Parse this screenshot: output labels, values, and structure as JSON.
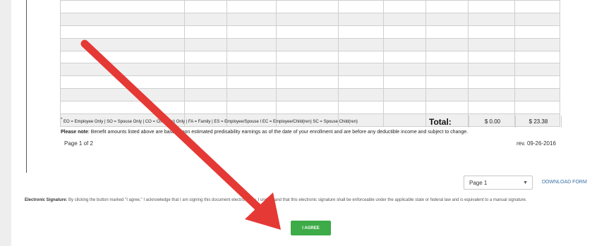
{
  "document": {
    "legend": "EO = Employee Only | SO = Spouse Only | CO = Child(ren) Only | FA = Family | ES = Employee/Spouse I EC = Employee/Child(ren) SC = Spouse Child(ren)",
    "legend_marker": "*",
    "total_label": "Total:",
    "totals": [
      "$ 0.00",
      "$ 23.38"
    ],
    "note_label": "Please note",
    "note_text": ": Benefit amounts listed above are based upon estimated predisability earnings as of the date of your enrollment and are before any deductible income and subject to change.",
    "page_indicator": "Page 1 of 2",
    "revision": "rev. 09-26-2016"
  },
  "controls": {
    "page_select_value": "Page 1",
    "download_label": "DOWNLOAD FORM",
    "agree_label": "I AGREE"
  },
  "signature": {
    "label": "Electronic Signature:",
    "text": " By clicking the button marked \"I agree,\" I acknowledge that I am signing this document electronically. I understand that this electronic signature shall be enforceable under the applicable state or federal law and is equivalent to a manual signature."
  },
  "colors": {
    "agree_button": "#3dab47",
    "annotation_arrow": "#e53935",
    "link": "#3a6ea5"
  },
  "icons": {
    "select_caret": "▼"
  }
}
